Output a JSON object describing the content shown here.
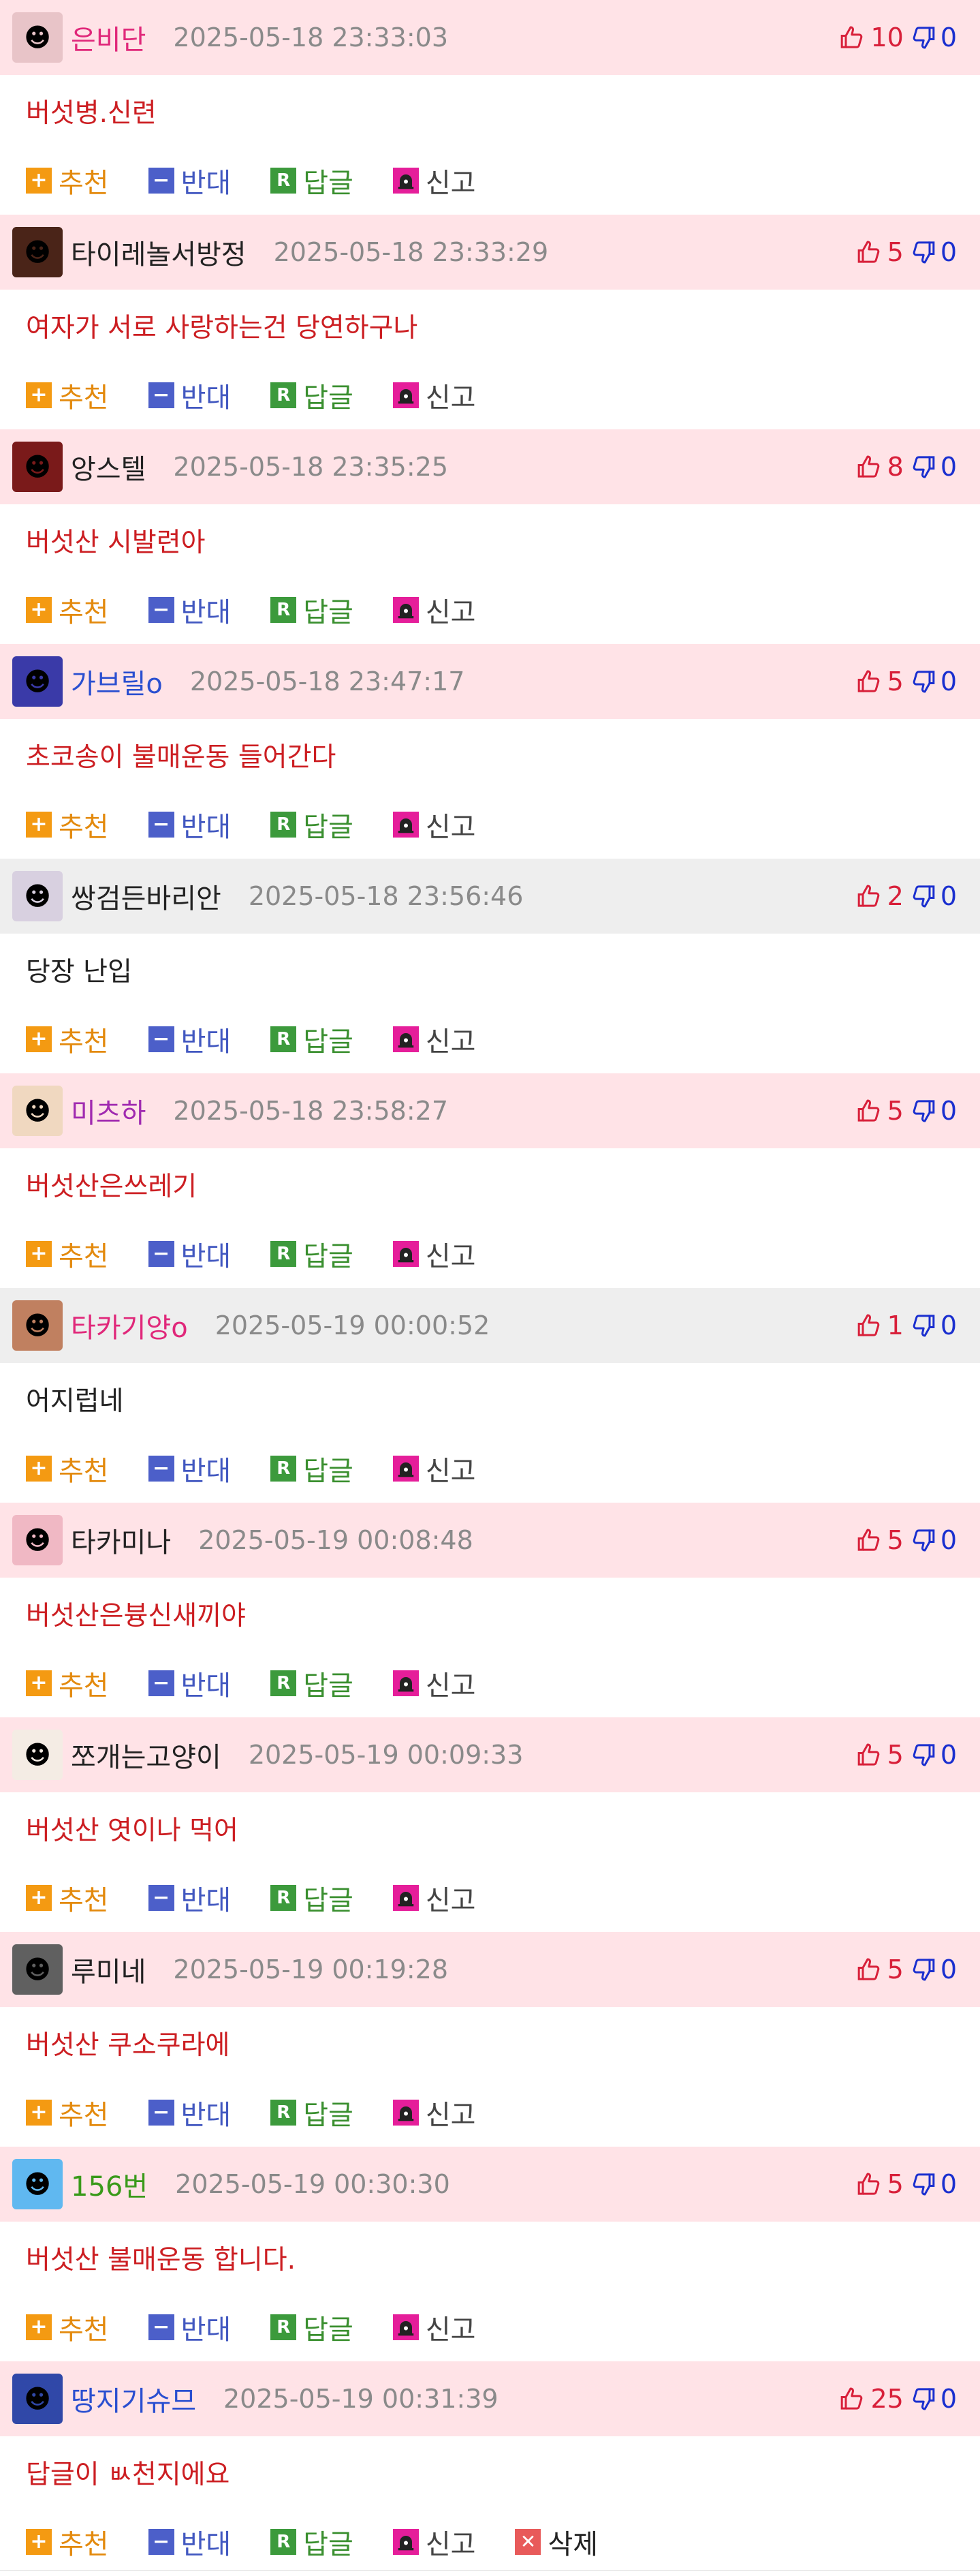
{
  "actions": {
    "recommend": "추천",
    "oppose": "반대",
    "reply": "답글",
    "report": "신고",
    "delete": "삭제"
  },
  "colors": {
    "row_pink": "#ffe3e7",
    "row_gray": "#eeeeee",
    "body_red": "#cc1e22",
    "up_red": "#d8203a",
    "down_blue": "#1a2fcf"
  },
  "comments": [
    {
      "nick": "은비단",
      "nick_color": "#e0287a",
      "date": "2025-05-18 23:33:03",
      "text": "버섯병.신련",
      "up": "10",
      "down": "0",
      "bg": "pink",
      "avatar_color": "#e8c4c8",
      "avatar_icon": "anime-girl-avatar"
    },
    {
      "nick": "타이레놀서방정",
      "nick_color": "#222222",
      "date": "2025-05-18 23:33:29",
      "text": "여자가 서로 사랑하는건 당연하구나",
      "up": "5",
      "down": "0",
      "bg": "pink",
      "avatar_color": "#4a2418",
      "avatar_icon": "dark-figure-avatar"
    },
    {
      "nick": "앙스텔",
      "nick_color": "#222222",
      "date": "2025-05-18 23:35:25",
      "text": "버섯산 시발련아",
      "up": "8",
      "down": "0",
      "bg": "pink",
      "avatar_color": "#7a1a1a",
      "avatar_icon": "red-character-avatar"
    },
    {
      "nick": "가브릴o",
      "nick_color": "#2a4fd0",
      "date": "2025-05-18 23:47:17",
      "text": "초코송이 불매운동 들어간다",
      "up": "5",
      "down": "0",
      "bg": "pink",
      "avatar_color": "#3a3aa8",
      "avatar_icon": "purple-character-avatar"
    },
    {
      "nick": "쌍검든바리안",
      "nick_color": "#222222",
      "date": "2025-05-18 23:56:46",
      "text": "당장 난입",
      "up": "2",
      "down": "0",
      "bg": "gray",
      "avatar_color": "#d8d0e0",
      "avatar_icon": "swordsman-avatar"
    },
    {
      "nick": "미츠하",
      "nick_color": "#a02ab0",
      "date": "2025-05-18 23:58:27",
      "text": "버섯산은쓰레기",
      "up": "5",
      "down": "0",
      "bg": "pink",
      "avatar_color": "#f0d8c0",
      "avatar_icon": "manga-face-avatar"
    },
    {
      "nick": "타카기양o",
      "nick_color": "#e0287a",
      "date": "2025-05-19 00:00:52",
      "text": "어지럽네",
      "up": "1",
      "down": "0",
      "bg": "gray",
      "avatar_color": "#c08060",
      "avatar_icon": "brown-hair-girl-avatar"
    },
    {
      "nick": "타카미나",
      "nick_color": "#222222",
      "date": "2025-05-19 00:08:48",
      "text": "버섯산은븅신새끼야",
      "up": "5",
      "down": "0",
      "bg": "pink",
      "avatar_color": "#f0b8c4",
      "avatar_icon": "pink-blossom-avatar"
    },
    {
      "nick": "쪼개는고양이",
      "nick_color": "#222222",
      "date": "2025-05-19 00:09:33",
      "text": "버섯산 엿이나 먹어",
      "up": "5",
      "down": "0",
      "bg": "pink",
      "avatar_color": "#f4ece4",
      "avatar_icon": "cat-face-avatar"
    },
    {
      "nick": "루미네",
      "nick_color": "#222222",
      "date": "2025-05-19 00:19:28",
      "text": "버섯산 쿠소쿠라에",
      "up": "5",
      "down": "0",
      "bg": "pink",
      "avatar_color": "#606060",
      "avatar_icon": "gray-character-avatar"
    },
    {
      "nick": "156번",
      "nick_color": "#3a9a1a",
      "date": "2025-05-19 00:30:30",
      "text": "버섯산 불매운동 합니다.",
      "up": "5",
      "down": "0",
      "bg": "pink",
      "avatar_color": "#60b8f0",
      "avatar_icon": "blue-fairy-avatar"
    },
    {
      "nick": "땅지기슈므",
      "nick_color": "#2a4fd0",
      "date": "2025-05-19 00:31:39",
      "text": "답글이 ㅄ천지에요",
      "up": "25",
      "down": "0",
      "bg": "pink",
      "avatar_color": "#3048a8",
      "avatar_icon": "navy-character-avatar",
      "deletable": true
    }
  ]
}
